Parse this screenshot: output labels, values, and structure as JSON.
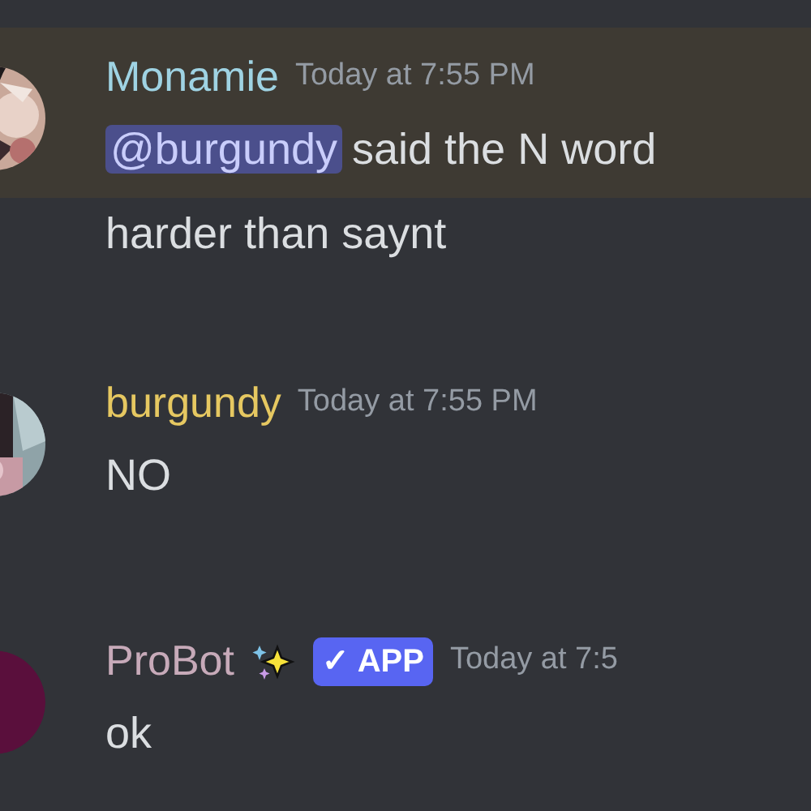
{
  "messages": [
    {
      "kind": "user",
      "author": "Monamie",
      "color": "#9fd3e3",
      "timestamp": "Today at 7:55 PM",
      "highlighted": true,
      "parts": [
        {
          "kind": "mention",
          "text": "@burgundy"
        },
        {
          "kind": "text",
          "text": "said the N word"
        }
      ]
    },
    {
      "kind": "continuation",
      "highlighted": false,
      "parts": [
        {
          "kind": "text",
          "text": "harder than saynt"
        }
      ]
    },
    {
      "kind": "user",
      "author": "burgundy",
      "color": "#e6c861",
      "timestamp": "Today at 7:55 PM",
      "highlighted": false,
      "parts": [
        {
          "kind": "text",
          "text": "NO"
        }
      ]
    },
    {
      "kind": "bot",
      "author": "ProBot",
      "color": "#c7aab9",
      "timestamp": "Today at 7:5",
      "highlighted": false,
      "tag": "✓ APP",
      "parts": [
        {
          "kind": "text",
          "text": "ok"
        }
      ]
    }
  ]
}
